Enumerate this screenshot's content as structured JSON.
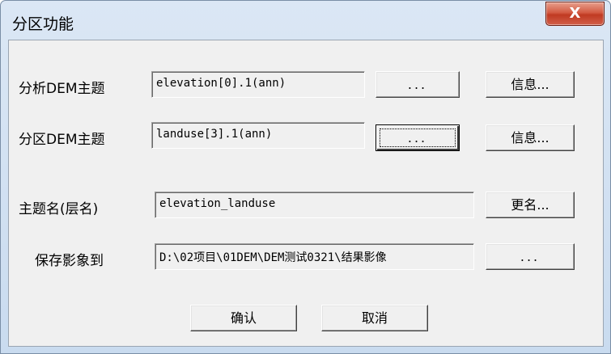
{
  "window": {
    "title": "分区功能",
    "close_glyph": "X"
  },
  "rows": [
    {
      "label": "分析DEM主题",
      "value": "elevation[0].1(ann)",
      "browse_label": "...",
      "action_label": "信息..."
    },
    {
      "label": "分区DEM主题",
      "value": "landuse[3].1(ann)",
      "browse_label": "...",
      "action_label": "信息..."
    },
    {
      "label": "主题名(层名)",
      "value": "elevation_landuse",
      "action_label": "更名..."
    },
    {
      "label": "保存影象到",
      "value": "D:\\02项目\\01DEM\\DEM测试0321\\结果影像",
      "browse_label": "..."
    }
  ],
  "footer": {
    "ok_label": "确认",
    "cancel_label": "取消"
  }
}
